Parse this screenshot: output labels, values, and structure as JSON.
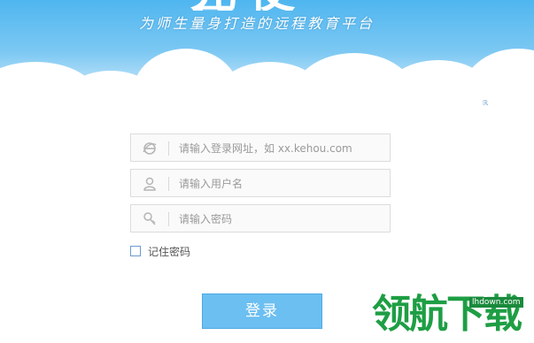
{
  "header": {
    "brand_partial": "兄使量",
    "tagline": "为师生量身打造的远程教育平台"
  },
  "login_form": {
    "url_field": {
      "placeholder": "请输入登录网址，如 xx.kehou.com",
      "icon": "ie-browser-icon"
    },
    "username_field": {
      "placeholder": "请输入用户名",
      "icon": "user-icon"
    },
    "password_field": {
      "placeholder": "请输入密码",
      "icon": "key-icon"
    },
    "remember_label": "记住密码",
    "submit_label": "登录"
  },
  "corner_marks": {
    "top_right_tiny": "ℝ"
  },
  "watermark": {
    "url": "lhdown.com",
    "brand": "领航下载"
  },
  "colors": {
    "sky_top": "#4fb6ef",
    "button_bg": "#6cbff1",
    "watermark_green": "#1e9e44"
  }
}
